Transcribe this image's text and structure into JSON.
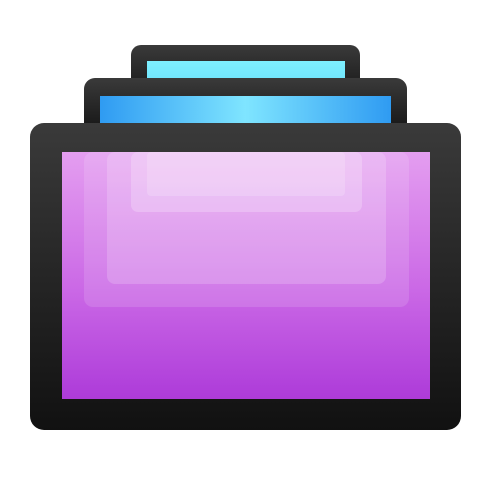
{
  "icon": {
    "name": "stacked-screens-app-icon",
    "colors": {
      "background": "#ffffff",
      "bezel_dark": "#1a1a1a",
      "bezel_light": "#3a3a3a",
      "back_screen_top": "#79ecff",
      "back_screen_bottom": "#63dcfb",
      "middle_screen_top": "#5ecbff",
      "middle_screen_bottom": "#2f9bf2",
      "front_screen_top": "#e7a3f1",
      "front_screen_bottom": "#b03ddb",
      "inner_panel_tint": "#f6dcfb"
    }
  }
}
